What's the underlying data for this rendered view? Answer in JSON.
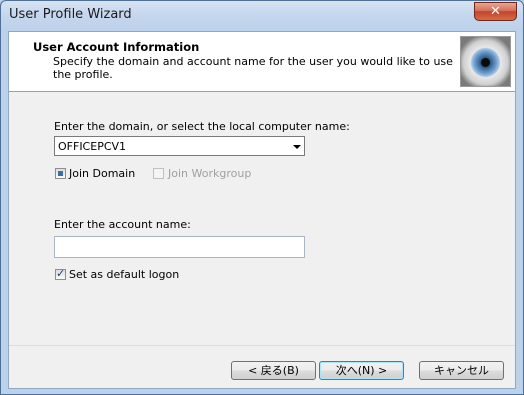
{
  "window": {
    "title": "User Profile Wizard",
    "close_label": "✕"
  },
  "header": {
    "title": "User Account Information",
    "description": "Specify the domain and account name for the user you would like to use the profile."
  },
  "domain": {
    "label": "Enter the domain, or select the local computer name:",
    "value": "OFFICEPCV1"
  },
  "options": {
    "join_domain": "Join Domain",
    "join_workgroup": "Join Workgroup"
  },
  "account": {
    "label": "Enter the account name:",
    "value": ""
  },
  "default_logon": {
    "label": "Set as default logon",
    "checked": true
  },
  "buttons": {
    "back": "< 戻る(B)",
    "next": "次へ(N) >",
    "cancel": "キャンセル"
  },
  "colors": {
    "accent": "#3a6ea5",
    "title_bar": "#bcd1ea"
  },
  "icons": {
    "header_image": "eye-icon",
    "combo_arrow": "chevron-down-icon"
  }
}
